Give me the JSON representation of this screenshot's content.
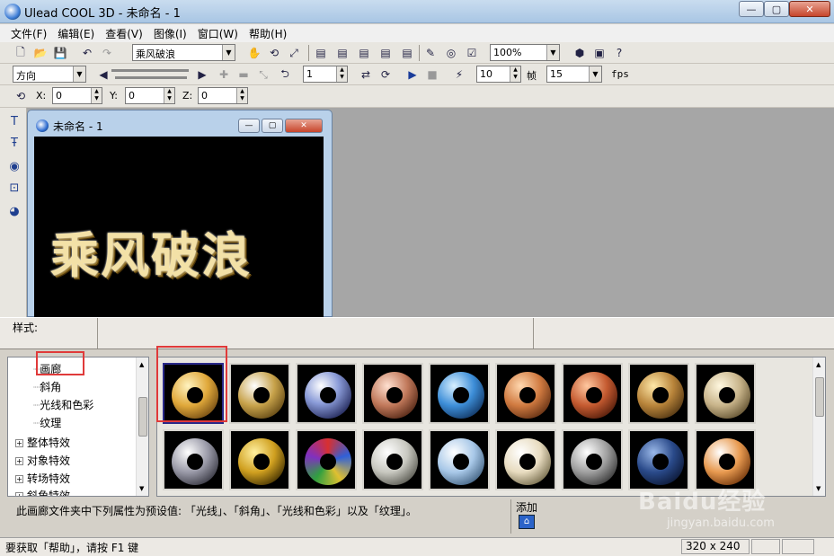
{
  "window": {
    "title": "Ulead COOL 3D - 未命名 - 1",
    "min": "—",
    "max": "▢",
    "close": "✕"
  },
  "menu": [
    "文件(F)",
    "编辑(E)",
    "查看(V)",
    "图像(I)",
    "窗口(W)",
    "帮助(H)"
  ],
  "toolbar1": {
    "text_value": "乘风破浪",
    "zoom_value": "100%"
  },
  "toolbar2": {
    "direction_value": "方向",
    "frame_value": "1",
    "frames_count": "10",
    "frame_label": "帧",
    "fps_value": "15",
    "fps_label": "fps"
  },
  "toolbar3": {
    "x_label": "X:",
    "x_value": "0",
    "y_label": "Y:",
    "y_value": "0",
    "z_label": "Z:",
    "z_value": "0"
  },
  "document": {
    "title": "未命名 - 1",
    "canvas_text": "乘风破浪"
  },
  "style_label": "样式:",
  "tree": {
    "items": [
      "画廊",
      "斜角",
      "光线和色彩",
      "纹理"
    ],
    "groups": [
      "整体特效",
      "对象特效",
      "转场特效",
      "斜角特效"
    ]
  },
  "thumbnails": {
    "row1": [
      "gold",
      "gold-glossy",
      "silver-blue",
      "copper",
      "blue-textured",
      "copper-wood",
      "copper-marble",
      "bronze",
      "stone-pattern"
    ],
    "row2": [
      "silver-rivet",
      "gold-black-spots",
      "stained-glass",
      "white-marble",
      "pale-blue",
      "cream",
      "metal-rivet",
      "blue-stone",
      "orange-glow"
    ]
  },
  "description": "此画廊文件夹中下列属性为预设值: 「光线」、「斜角」、「光线和色彩」以及「纹理」。",
  "add_label": "添加",
  "status": {
    "help_text": "要获取「帮助」，请按 F1 键",
    "size": "320 x 240"
  },
  "watermark": {
    "brand": "Baidu经验",
    "url": "jingyan.baidu.com"
  }
}
